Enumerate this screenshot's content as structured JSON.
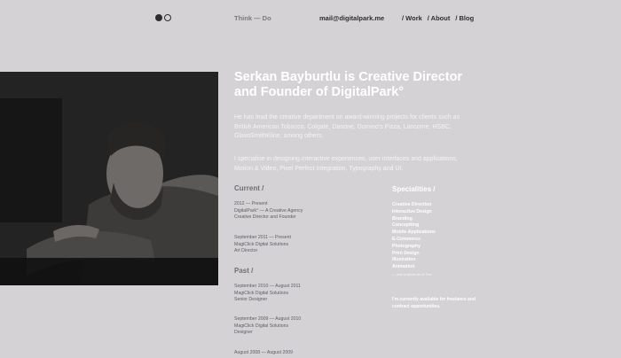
{
  "header": {
    "tagline": "Think — Do",
    "email": "mail@digitalpark.me",
    "nav": [
      "/ Work",
      "/ About",
      "/ Blog"
    ]
  },
  "hero": {
    "headline_line1": "Serkan Bayburtlu is Creative Director",
    "headline_line2": "and Founder of DigitalPark°",
    "intro": "He has lead the creative department on award-winning projects for clients such as British American Tobacco, Colgate, Danone, Domino's Pizza, Lancome, HSBC, GlaxoSmithKline, among others.",
    "intro2": "I specialise in designing interactive experiences, user interfaces and applications, Motion & Video, Pixel Perfect Integration, Typography and UI."
  },
  "current": {
    "title": "Current /",
    "entries": [
      {
        "dates": "2012 — Present",
        "company": "DigitalPark° — A Creative Agency",
        "role": "Creative Director and Founder"
      },
      {
        "dates": "September 2011 — Present",
        "company": "MagiClick Digital Solutions",
        "role": "Art Director"
      }
    ]
  },
  "past": {
    "title": "Past /",
    "entries": [
      {
        "dates": "September 2010 — August 2011",
        "company": "MagiClick Digital Solutions",
        "role": "Senior Designer"
      },
      {
        "dates": "September 2009 — August 2010",
        "company": "MagiClick Digital Solutions",
        "role": "Designer"
      },
      {
        "dates": "August 2008 — August 2009"
      }
    ]
  },
  "specialities": {
    "title": "Specialities /",
    "items": [
      "Creative Direction",
      "Interactive Design",
      "Branding",
      "Conceptting",
      "Mobile Applications",
      "E-Commerce",
      "Photography",
      "Print Design",
      "Illustration",
      "Animation"
    ],
    "note": "— and a whole lot of Tea",
    "freelance": "I'm currently available for freelance and contract opportunities."
  }
}
